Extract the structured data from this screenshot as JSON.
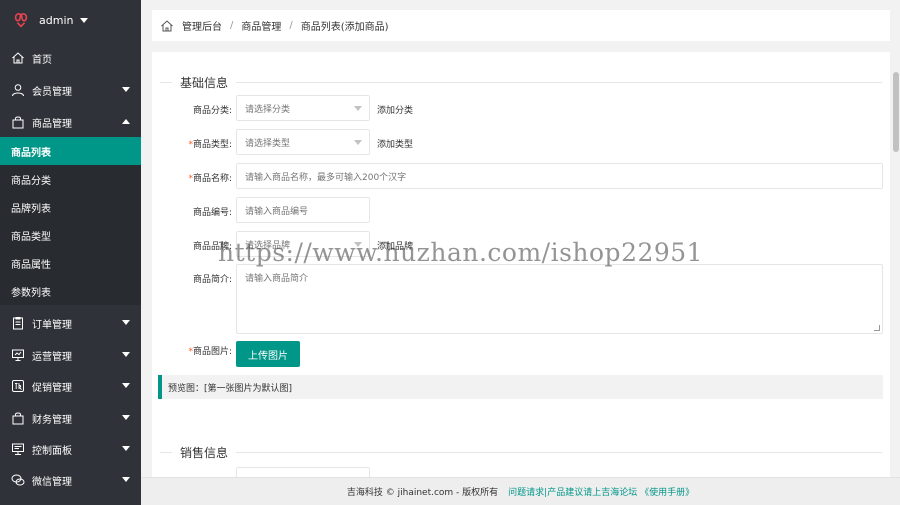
{
  "sidebar": {
    "username": "admin",
    "nav": {
      "home": "首页",
      "members": "会员管理",
      "goods": "商品管理",
      "orders": "订单管理",
      "operations": "运营管理",
      "promotions": "促销管理",
      "finance": "财务管理",
      "control": "控制面板",
      "wechat": "微信管理"
    },
    "sub": {
      "goods_list": "商品列表",
      "goods_category": "商品分类",
      "brand_list": "品牌列表",
      "goods_type": "商品类型",
      "goods_attr": "商品属性",
      "param_list": "参数列表"
    }
  },
  "breadcrumb": {
    "items": [
      "管理后台",
      "商品管理",
      "商品列表(添加商品)"
    ],
    "separator": "/"
  },
  "form": {
    "basic_section": "基础信息",
    "sales_section": "销售信息",
    "category": {
      "label": "商品分类:",
      "placeholder": "请选择分类",
      "link": "添加分类"
    },
    "type": {
      "required_mark": "*",
      "label": "商品类型:",
      "placeholder": "请选择类型",
      "link": "添加类型"
    },
    "name": {
      "required_mark": "*",
      "label": "商品名称:",
      "placeholder": "请输入商品名称，最多可输入200个汉字"
    },
    "code": {
      "label": "商品编号:",
      "placeholder": "请输入商品编号"
    },
    "brand": {
      "label": "商品品牌:",
      "placeholder": "请选择品牌",
      "link": "添加品牌"
    },
    "intro": {
      "label": "商品简介:",
      "placeholder": "请输入商品简介"
    },
    "image": {
      "required_mark": "*",
      "label": "商品图片:",
      "button": "上传图片"
    },
    "preview_text": "预览图：[第一张图片为默认图]"
  },
  "watermark": "https://www.huzhan.com/ishop22951",
  "footer": {
    "copyright": "吉海科技 © jihainet.com - 版权所有",
    "links": "问题请求|产品建议请上吉海论坛 《使用手册》"
  },
  "colors": {
    "accent": "#009688",
    "sidebar_bg": "#2f3339",
    "required": "#ff5722"
  }
}
